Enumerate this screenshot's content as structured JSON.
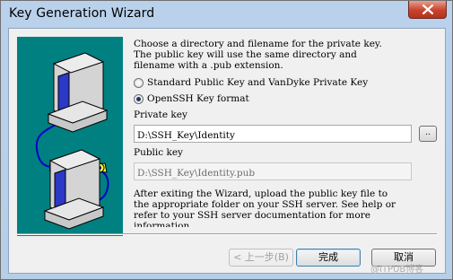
{
  "window": {
    "title": "Key Generation Wizard"
  },
  "titlebar": {
    "close_icon": "close-x-icon"
  },
  "illustration": {
    "icons": [
      "computer-icon",
      "key-icon",
      "computer-icon"
    ]
  },
  "content": {
    "description": "Choose a directory and filename for the private key.\nThe public key will use the same directory and\nfilename with a .pub extension.",
    "format_options": [
      {
        "label": "Standard Public Key and VanDyke Private Key",
        "checked": false
      },
      {
        "label": "OpenSSH Key format",
        "checked": true
      }
    ],
    "private_key": {
      "label": "Private key",
      "value": "D:\\SSH_Key\\Identity",
      "browse_label": ".."
    },
    "public_key": {
      "label": "Public key",
      "value": "D:\\SSH_Key\\Identity.pub"
    },
    "after_text": "After exiting the Wizard, upload the public key file to\nthe appropriate folder on your SSH server.  See help or\nrefer to your SSH server documentation for more\ninformation."
  },
  "buttons": {
    "back": "< 上一步(B)",
    "finish": "完成",
    "cancel": "取消"
  },
  "watermark": "@ITPUB博客",
  "colors": {
    "illustration_bg": "#008080",
    "dialog_bg": "#f0f0f0",
    "close_button": "#c7432c"
  }
}
